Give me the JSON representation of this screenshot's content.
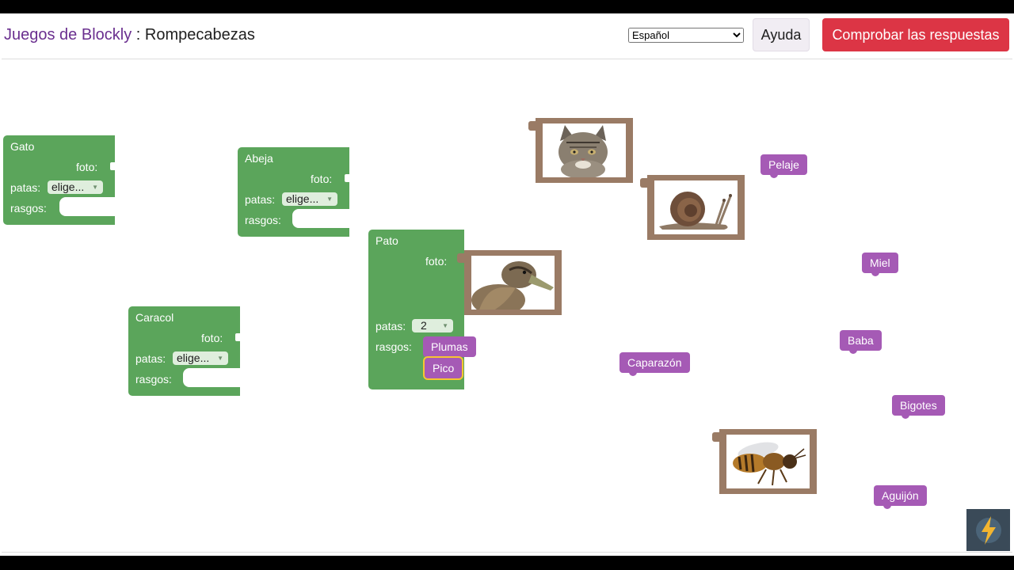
{
  "header": {
    "brand": "Juegos de Blockly",
    "separator": " : ",
    "game": "Rompecabezas",
    "language_selected": "Español",
    "help_label": "Ayuda",
    "check_label": "Comprobar las respuestas"
  },
  "animals": {
    "gato": {
      "name": "Gato",
      "foto": "foto:",
      "patas": "patas:",
      "patas_value": "elige...",
      "rasgos": "rasgos:"
    },
    "abeja": {
      "name": "Abeja",
      "foto": "foto:",
      "patas": "patas:",
      "patas_value": "elige...",
      "rasgos": "rasgos:"
    },
    "caracol": {
      "name": "Caracol",
      "foto": "foto:",
      "patas": "patas:",
      "patas_value": "elige...",
      "rasgos": "rasgos:"
    },
    "pato": {
      "name": "Pato",
      "foto": "foto:",
      "patas": "patas:",
      "patas_value": "2",
      "rasgos": "rasgos:"
    }
  },
  "traits": {
    "plumas": "Plumas",
    "pico": "Pico",
    "pelaje": "Pelaje",
    "miel": "Miel",
    "baba": "Baba",
    "caparazon": "Caparazón",
    "bigotes": "Bigotes",
    "aguijon": "Aguijón"
  },
  "pictures": [
    "cat-photo",
    "snail-photo",
    "duck-photo",
    "bee-photo"
  ],
  "colors": {
    "animal_block": "#5ba55b",
    "trait_block": "#a55ab5",
    "picture_block": "#9a7b65",
    "check_button": "#dc3545",
    "brand_link": "#6a2f8f"
  }
}
